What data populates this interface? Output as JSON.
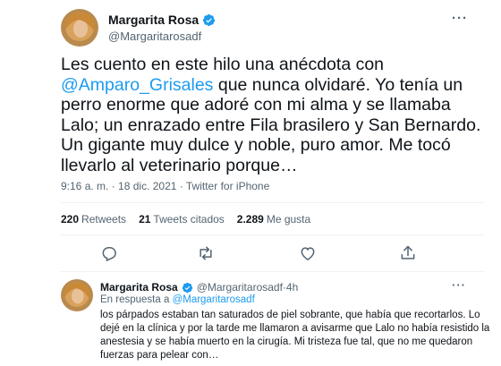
{
  "tweet": {
    "author_name": "Margarita Rosa",
    "author_handle": "@Margaritarosadf",
    "more_label": "···",
    "text_before_mention": "Les cuento en este hilo una anécdota con ",
    "mention": "@Amparo_Grisales",
    "text_after_mention": " que nunca olvidaré. Yo tenía un perro enorme que adoré con mi alma y se llamaba Lalo; un enrazado entre Fila brasilero y San Bernardo. Un gigante muy dulce y noble, puro amor. Me tocó llevarlo al veterinario porque…",
    "time": "9:16 a. m.",
    "sep": " · ",
    "date": "18 dic. 2021",
    "source": "Twitter for iPhone",
    "stats": {
      "retweets_count": "220",
      "retweets_label": "Retweets",
      "quotes_count": "21",
      "quotes_label": "Tweets citados",
      "likes_count": "2.289",
      "likes_label": "Me gusta"
    },
    "actions": [
      "reply-icon",
      "retweet-icon",
      "like-icon",
      "share-icon"
    ]
  },
  "reply": {
    "author_name": "Margarita Rosa",
    "author_handle": "@Margaritarosadf",
    "sep": " · ",
    "age": "4h",
    "replying_label": "En respuesta a ",
    "replying_to": "@Margaritarosadf",
    "more_label": "···",
    "text": "los párpados estaban tan saturados de piel sobrante, que había que recortarlos. Lo dejé en la clínica y por la tarde me llamaron a avisarme que Lalo no había resistido la anestesia y se había muerto en la cirugía. Mi tristeza fue tal, que no me quedaron fuerzas para pelear con…"
  },
  "colors": {
    "accent": "#1d9bf0",
    "text": "#0f1419",
    "secondary": "#536471",
    "divider": "#eff3f4"
  }
}
